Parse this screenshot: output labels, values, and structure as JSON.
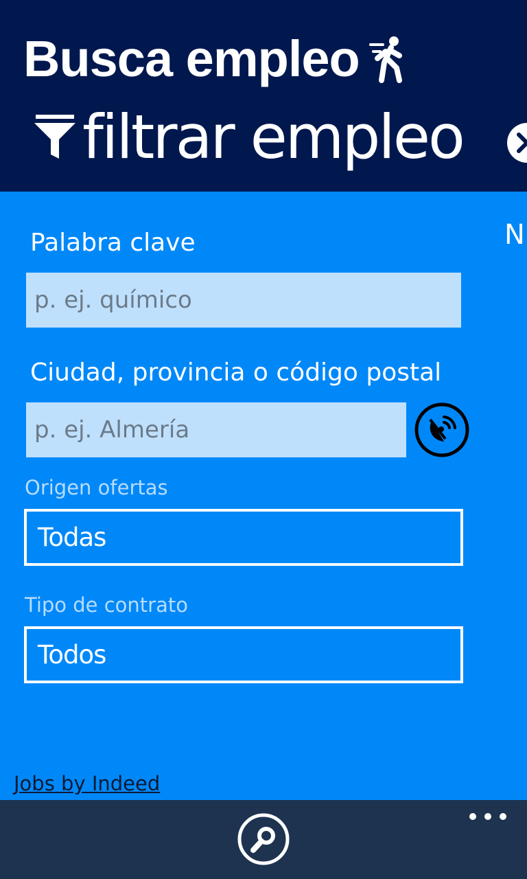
{
  "header": {
    "app_title": "Busca empleo",
    "pivot_title": "filtrar empleo",
    "next_pivot_peek": "N"
  },
  "form": {
    "keyword": {
      "label": "Palabra clave",
      "value": "",
      "placeholder": "p. ej. químico"
    },
    "location": {
      "label": "Ciudad, provincia o código postal",
      "value": "",
      "placeholder": "p. ej. Almería"
    },
    "source": {
      "label": "Origen ofertas",
      "value": "Todas"
    },
    "contract": {
      "label": "Tipo de contrato",
      "value": "Todos"
    }
  },
  "footer": {
    "link_text": "Jobs by Indeed"
  },
  "icons": {
    "title": "person-walking-icon",
    "pivot": "filter-icon",
    "pivot_next": "close-circle-icon",
    "location": "satellite-dish-icon",
    "appbar_search": "search-icon",
    "appbar_more": "more-dots-icon"
  },
  "colors": {
    "background": "#0088f9",
    "header": "#00184e",
    "input_fill": "#bfe0fd",
    "appbar": "#1d3350",
    "link": "#0c1a33"
  }
}
